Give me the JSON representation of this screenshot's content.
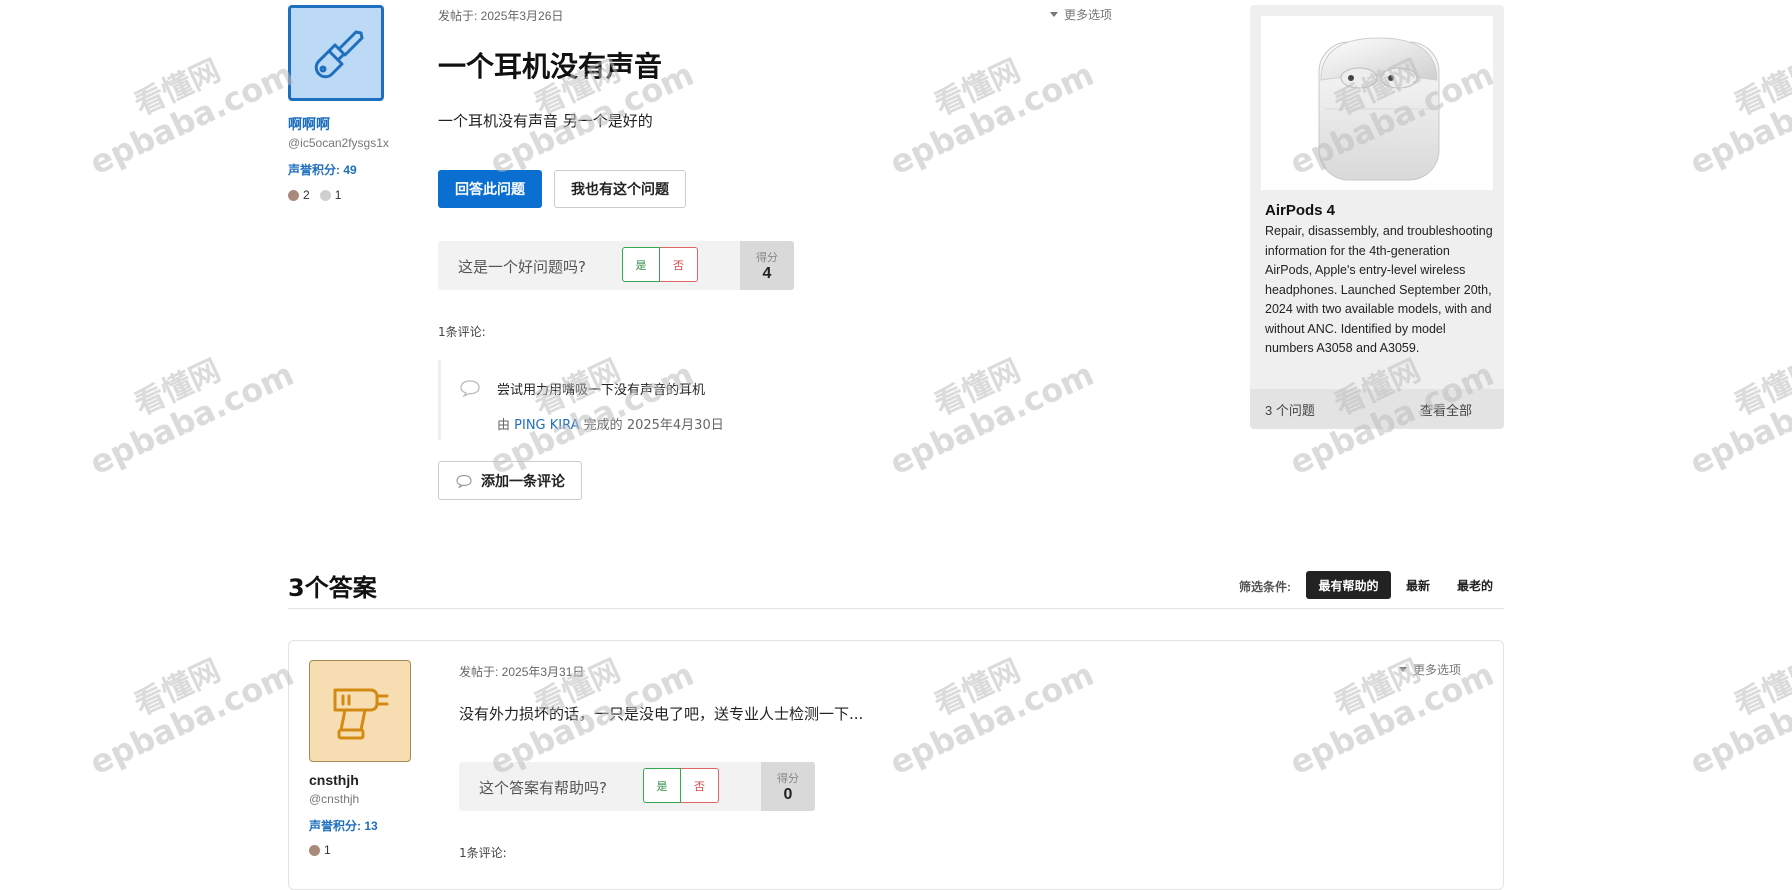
{
  "question": {
    "author": {
      "name": "啊啊啊",
      "handle": "@ic5ocan2fysgs1x",
      "reputation": "声誉积分: 49",
      "badges": [
        {
          "count": "2",
          "color": "#a98a7a"
        },
        {
          "count": "1",
          "color": "#cfcfcf"
        }
      ]
    },
    "posted": "发帖于: 2025年3月26日",
    "more_options": "更多选项",
    "title": "一个耳机没有声音",
    "body": "一个耳机没有声音 另一个是好的",
    "answer_button": "回答此问题",
    "same_problem_button": "我也有这个问题",
    "vote": {
      "question": "这是一个好问题吗?",
      "yes": "是",
      "no": "否",
      "score_label": "得分",
      "score": "4"
    },
    "comments_count": "1条评论:",
    "comment": {
      "text": "尝试用力用嘴吸一下没有声音的耳机",
      "by_prefix": "由",
      "by_user": "PING KIRA",
      "by_suffix": "完成的",
      "date": "2025年4月30日"
    },
    "add_comment": "添加一条评论"
  },
  "sidebar": {
    "product_title": "AirPods 4",
    "product_desc": "Repair, disassembly, and troubleshooting information for the 4th-generation AirPods, Apple's entry-level wireless headphones. Launched September 20th, 2024 with two available models, with and without ANC. Identified by model numbers A3058 and A3059.",
    "questions_count": "3 个问题",
    "view_all": "查看全部"
  },
  "answers": {
    "heading": "3个答案",
    "filter_label": "筛选条件:",
    "filters": [
      "最有帮助的",
      "最新",
      "最老的"
    ],
    "first": {
      "author": {
        "name": "cnsthjh",
        "handle": "@cnsthjh",
        "reputation": "声誉积分: 13",
        "badges": [
          {
            "count": "1",
            "color": "#a98a7a"
          }
        ]
      },
      "posted": "发帖于: 2025年3月31日",
      "more_options": "更多选项",
      "body": "没有外力损坏的话，一只是没电了吧，送专业人士检测一下...",
      "vote": {
        "question": "这个答案有帮助吗?",
        "yes": "是",
        "no": "否",
        "score_label": "得分",
        "score": "0"
      },
      "comments_count": "1条评论:"
    }
  },
  "watermark": {
    "line1": "看懂网",
    "line2": "epbaba.com"
  },
  "colors": {
    "accent": "#0a6fd1",
    "link": "#1f6fbf",
    "yes": "#34a853",
    "no": "#e06666"
  }
}
